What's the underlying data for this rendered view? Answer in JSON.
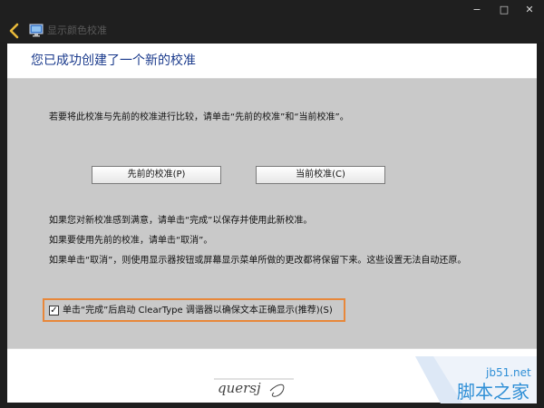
{
  "window": {
    "minimize_glyph": "−",
    "maximize_glyph": "□",
    "close_glyph": "✕"
  },
  "nav": {
    "app_title": "显示颜色校准"
  },
  "header": {
    "title": "您已成功创建了一个新的校准"
  },
  "content": {
    "compare_text": "若要将此校准与先前的校准进行比较，请单击“先前的校准”和“当前校准”。",
    "prev_button": "先前的校准(P)",
    "current_button": "当前校准(C)",
    "satisfied_text": "如果您对新校准感到满意，请单击“完成”以保存并使用此新校准。",
    "use_previous_text": "如果要使用先前的校准，请单击“取消”。",
    "cancel_note_text": "如果单击“取消”，则使用显示器按钮或屏幕显示菜单所做的更改都将保留下来。这些设置无法自动还原。",
    "cleartype_checkbox": {
      "label": "单击“完成”后启动 ClearType 调谐器以确保文本正确显示(推荐)(S)",
      "checked": true,
      "check_glyph": "✓"
    }
  },
  "footer": {
    "signature": "quersj",
    "watermark_domain": "jb51.net",
    "watermark_name": "脚本之家"
  },
  "colors": {
    "title_blue": "#1a3a8c",
    "highlight_orange": "#e8873a",
    "back_arrow": "#e8b93a",
    "watermark_blue": "#2f8fd6"
  }
}
